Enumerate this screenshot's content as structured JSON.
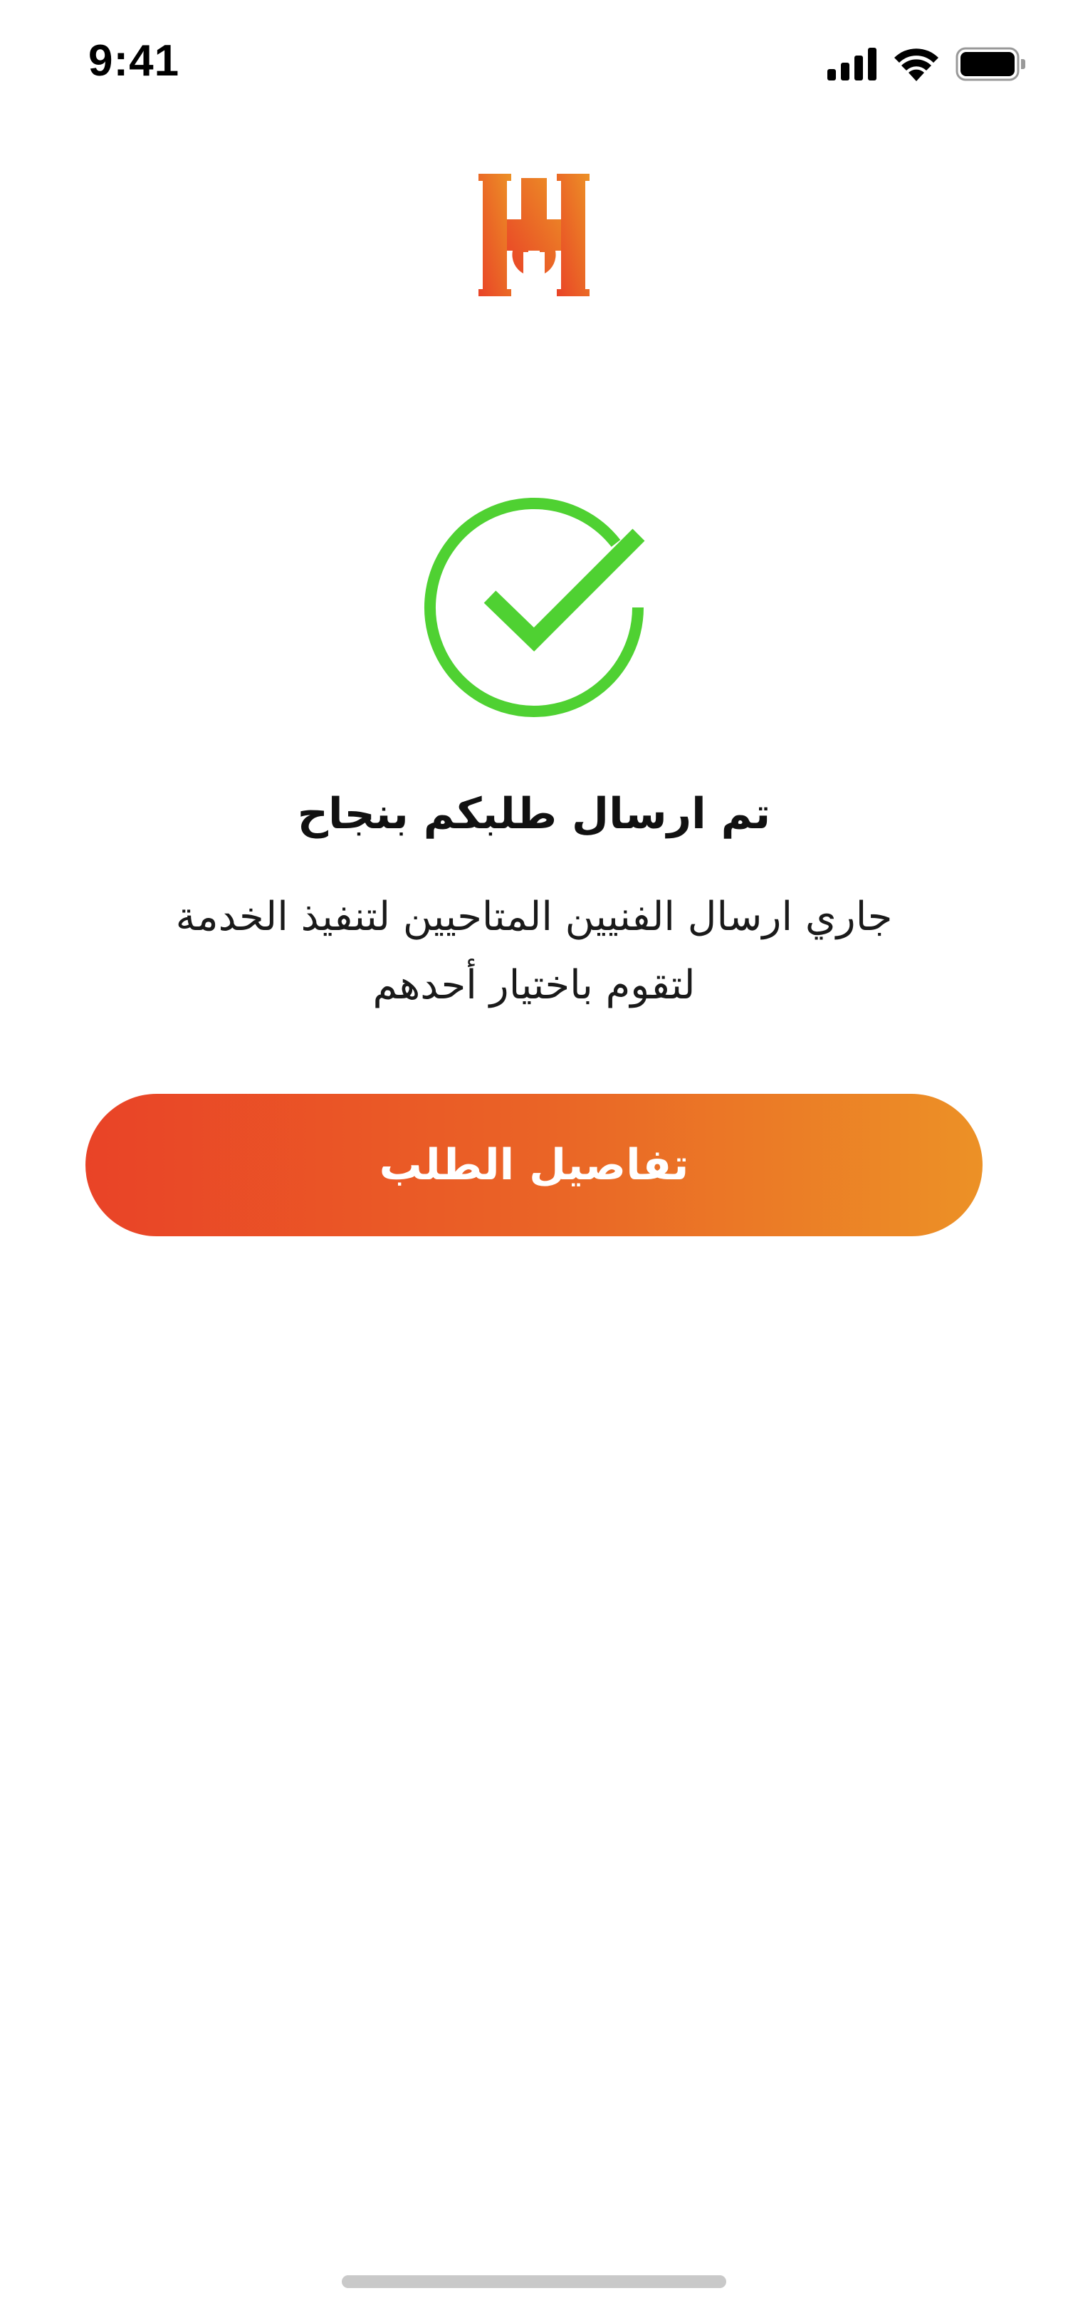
{
  "status_bar": {
    "time": "9:41",
    "icons": [
      "cellular-signal-icon",
      "wifi-icon",
      "battery-icon"
    ]
  },
  "logo": {
    "name": "app-logo-icon",
    "colors": [
      "#E94327",
      "#EC9126"
    ]
  },
  "success": {
    "icon": "check-circle-icon",
    "color": "#4FD132",
    "title": "تم ارسال طلبكم بنجاح",
    "message_line1": "جاري ارسال الفنيين المتاحيين لتنفيذ الخدمة",
    "message_line2": "لتقوم باختيار أحدهم"
  },
  "actions": {
    "details_button_label": "تفاصيل الطلب",
    "button_gradient": [
      "#E94327",
      "#EC9126"
    ]
  }
}
